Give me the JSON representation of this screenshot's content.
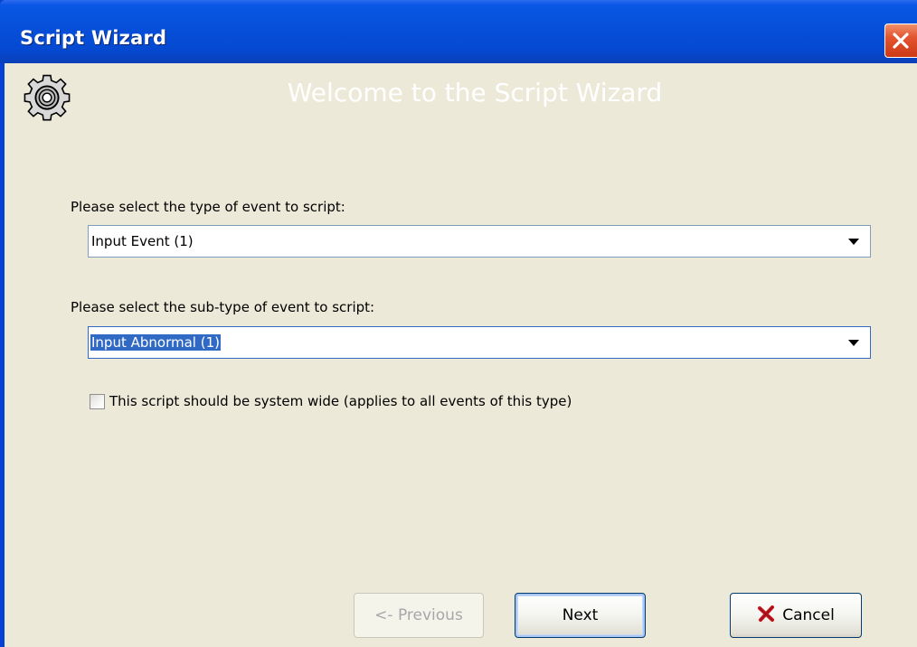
{
  "window": {
    "title": "Script Wizard",
    "close_icon": "close-icon",
    "titlebar_color": "#0550D8"
  },
  "header": {
    "icon": "gear-icon",
    "welcome_text": "Welcome to the Script Wizard"
  },
  "event_type": {
    "label": "Please select the type of event to script:",
    "selected": "Input Event  (1)"
  },
  "event_subtype": {
    "label": "Please select the sub-type of event to script:",
    "selected": "Input Abnormal  (1)"
  },
  "system_wide": {
    "label": "This script should be system wide (applies to all events of this type)",
    "checked": false
  },
  "buttons": {
    "previous": "<- Previous",
    "next": "Next",
    "cancel": "Cancel",
    "cancel_icon": "red-x-icon"
  }
}
